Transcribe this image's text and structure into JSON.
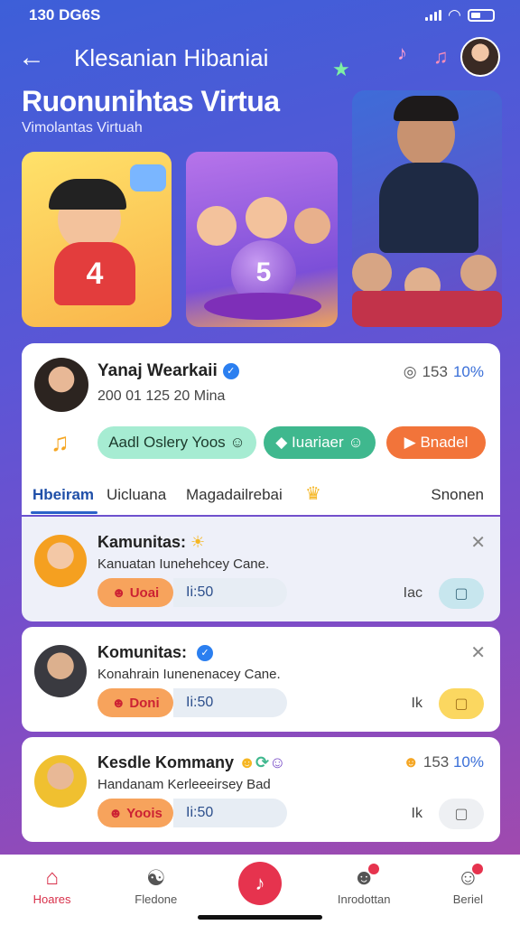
{
  "status_bar": {
    "time": "130 DG6S"
  },
  "header": {
    "title": "Klesanian Hibaniai"
  },
  "hero": {
    "title": "Ruonunihtas Virtua",
    "subtitle": "Vimolantas Virtuah"
  },
  "colors": {
    "accent": "#e6334e",
    "primary": "#2b62c8",
    "background_top": "#3d5fd8",
    "background_bottom": "#a84aa8"
  },
  "tiles": [
    {
      "name": "cartoon-player-tile",
      "number": "4"
    },
    {
      "name": "group-orb-tile",
      "number": "5"
    },
    {
      "name": "celebration-photo-tile"
    }
  ],
  "profile": {
    "name": "Yanaj Wearkaii",
    "date": "200 01 125 20 Mina",
    "views": "153",
    "percent": "10%",
    "chips": [
      "Aadl Oslery Yoos",
      "Iuariaer",
      "Bnadel"
    ]
  },
  "tabs": [
    {
      "label": "Hbeiram"
    },
    {
      "label": "Uicluana"
    },
    {
      "label": "Magadailrebai"
    },
    {
      "label": "Snonen"
    }
  ],
  "posts": [
    {
      "title": "Kamunitas:",
      "subtitle": "Kanuatan Iunehehcey Cane.",
      "chip": "Uoai",
      "time": "Ii:50",
      "label": "Iac"
    },
    {
      "title": "Komunitas:",
      "subtitle": "Konahrain Iunenenacey Cane.",
      "chip": "Doni",
      "time": "Ii:50",
      "label": "Ik"
    },
    {
      "title": "Kesdle Kommany",
      "subtitle": "Handanam Kerleeeirsey Bad",
      "chip": "Yoois",
      "time": "Ii:50",
      "label": "Ik",
      "views": "153",
      "percent": "10%"
    }
  ],
  "bottom_nav": [
    {
      "label": "Hoares",
      "icon": "home-icon"
    },
    {
      "label": "Fledone",
      "icon": "people-icon"
    },
    {
      "label": "",
      "icon": "music-icon"
    },
    {
      "label": "Inrodottan",
      "icon": "notification-user-icon"
    },
    {
      "label": "Beriel",
      "icon": "profile-icon"
    }
  ]
}
